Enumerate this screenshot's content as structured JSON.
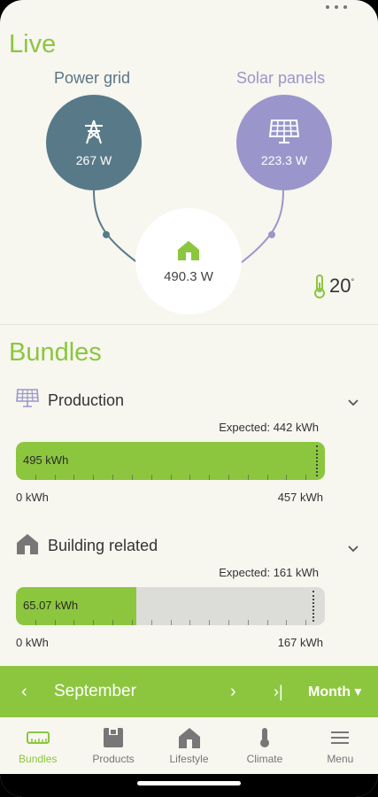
{
  "live": {
    "title": "Live",
    "grid": {
      "label": "Power grid",
      "value": "267 W",
      "icon": "power-pylon-icon"
    },
    "solar": {
      "label": "Solar panels",
      "value": "223.3 W",
      "icon": "solar-panel-icon"
    },
    "home": {
      "value": "490.3 W",
      "icon": "house-icon",
      "grid_share": 0.545
    },
    "temperature": {
      "value": "20",
      "unit": "°",
      "icon": "thermometer-icon"
    }
  },
  "bundles": {
    "title": "Bundles",
    "items": [
      {
        "label": "Production",
        "icon": "solar-panel-icon",
        "expected": "Expected: 442 kWh",
        "value_label": "495 kWh",
        "axis_min": "0 kWh",
        "axis_max": "457 kWh",
        "fill_fraction": 1.0,
        "expected_fraction": 0.97
      },
      {
        "label": "Building related",
        "icon": "house-icon",
        "expected": "Expected: 161 kWh",
        "value_label": "65.07 kWh",
        "axis_min": "0 kWh",
        "axis_max": "167 kWh",
        "fill_fraction": 0.39,
        "expected_fraction": 0.96
      }
    ]
  },
  "period": {
    "prev": "‹",
    "label": "September",
    "next": "›",
    "last": "›|",
    "mode": "Month ▾"
  },
  "nav": [
    {
      "label": "Bundles",
      "icon": "bundles-meter-icon",
      "active": true
    },
    {
      "label": "Products",
      "icon": "products-icon",
      "active": false
    },
    {
      "label": "Lifestyle",
      "icon": "house-icon",
      "active": false
    },
    {
      "label": "Climate",
      "icon": "thermometer-icon",
      "active": false
    },
    {
      "label": "Menu",
      "icon": "menu-icon",
      "active": false
    }
  ],
  "colors": {
    "accent": "#8cc63f",
    "grid": "#587a88",
    "solar": "#9a96cb",
    "background": "#f7f6ef"
  }
}
